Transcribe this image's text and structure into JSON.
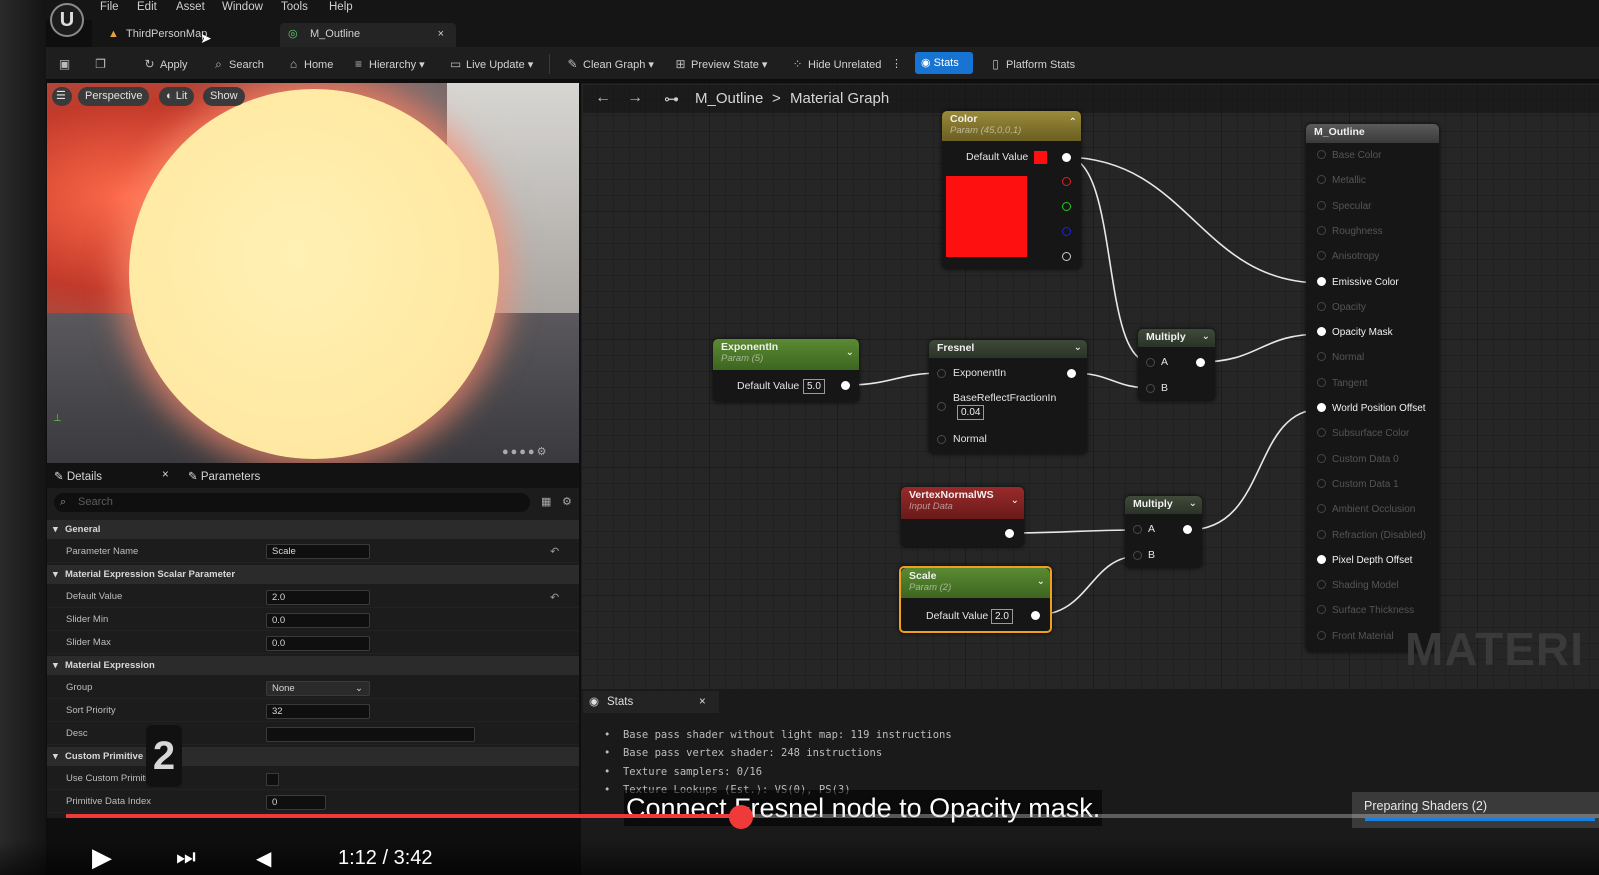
{
  "menu": [
    "File",
    "Edit",
    "Asset",
    "Window",
    "Tools",
    "Help"
  ],
  "tabs": [
    {
      "label": "ThirdPersonMap"
    },
    {
      "label": "M_Outline",
      "close": "×"
    }
  ],
  "toolbar": {
    "apply": "Apply",
    "search": "Search",
    "home": "Home",
    "hierarchy": "Hierarchy",
    "live_update": "Live Update",
    "clean_graph": "Clean Graph",
    "preview_state": "Preview State",
    "hide_unrelated": "Hide Unrelated",
    "stats": "Stats",
    "platform_stats": "Platform Stats"
  },
  "viewport": {
    "perspective": "Perspective",
    "lit": "Lit",
    "show": "Show"
  },
  "details": {
    "tab_details": "Details",
    "tab_close": "×",
    "tab_parameters": "Parameters",
    "search_placeholder": "Search",
    "sections": {
      "general": "General",
      "scalar": "Material Expression Scalar Parameter",
      "expression": "Material Expression",
      "custom": "Custom Primitive D..."
    },
    "props": {
      "parameter_name": {
        "label": "Parameter Name",
        "value": "Scale"
      },
      "default_value": {
        "label": "Default Value",
        "value": "2.0"
      },
      "slider_min": {
        "label": "Slider Min",
        "value": "0.0"
      },
      "slider_max": {
        "label": "Slider Max",
        "value": "0.0"
      },
      "group": {
        "label": "Group",
        "value": "None"
      },
      "sort_priority": {
        "label": "Sort Priority",
        "value": "32"
      },
      "desc": {
        "label": "Desc",
        "value": ""
      },
      "use_custom": {
        "label": "Use Custom Primiti..."
      },
      "primitive_index": {
        "label": "Primitive Data Index",
        "value": "0"
      }
    }
  },
  "graph": {
    "breadcrumb_asset": "M_Outline",
    "breadcrumb_sep": ">",
    "breadcrumb_graph": "Material Graph",
    "nodes": {
      "color": {
        "title": "Color",
        "subtitle": "Param (45,0,0,1)",
        "default_label": "Default Value",
        "swatch": "#ff1010"
      },
      "exponent": {
        "title": "ExponentIn",
        "subtitle": "Param (5)",
        "default_label": "Default Value",
        "value": "5.0"
      },
      "fresnel": {
        "title": "Fresnel",
        "pin_exponent": "ExponentIn",
        "pin_base": "BaseReflectFractionIn",
        "base_value": "0.04",
        "pin_normal": "Normal"
      },
      "multiply1": {
        "title": "Multiply",
        "a": "A",
        "b": "B"
      },
      "vertex": {
        "title": "VertexNormalWS",
        "subtitle": "Input Data"
      },
      "multiply2": {
        "title": "Multiply",
        "a": "A",
        "b": "B"
      },
      "scale": {
        "title": "Scale",
        "subtitle": "Param (2)",
        "default_label": "Default Value",
        "value": "2.0"
      },
      "output": {
        "title": "M_Outline",
        "pins": [
          {
            "label": "Base Color",
            "on": false
          },
          {
            "label": "Metallic",
            "on": false
          },
          {
            "label": "Specular",
            "on": false
          },
          {
            "label": "Roughness",
            "on": false
          },
          {
            "label": "Anisotropy",
            "on": false
          },
          {
            "label": "Emissive Color",
            "on": true
          },
          {
            "label": "Opacity",
            "on": false
          },
          {
            "label": "Opacity Mask",
            "on": true
          },
          {
            "label": "Normal",
            "on": false
          },
          {
            "label": "Tangent",
            "on": false
          },
          {
            "label": "World Position Offset",
            "on": true
          },
          {
            "label": "Subsurface Color",
            "on": false
          },
          {
            "label": "Custom Data 0",
            "on": false
          },
          {
            "label": "Custom Data 1",
            "on": false
          },
          {
            "label": "Ambient Occlusion",
            "on": false
          },
          {
            "label": "Refraction (Disabled)",
            "on": false
          },
          {
            "label": "Pixel Depth Offset",
            "on": true
          },
          {
            "label": "Shading Model",
            "on": false
          },
          {
            "label": "Surface Thickness",
            "on": false
          },
          {
            "label": "Front Material",
            "on": false
          }
        ]
      }
    },
    "watermark": "MATERI"
  },
  "stats": {
    "tab": "Stats",
    "close": "×",
    "lines": [
      "Base pass shader without light map: 119 instructions",
      "Base pass vertex shader: 248 instructions",
      "Texture samplers: 0/16",
      "Texture Lookups (Est.): VS(0), PS(3)"
    ]
  },
  "overlay": {
    "caption": "Connect Fresnel node to Opacity mask.",
    "preparing": "Preparing Shaders (2)",
    "badge": "2",
    "time": "1:12 / 3:42",
    "progress": 0.44
  }
}
